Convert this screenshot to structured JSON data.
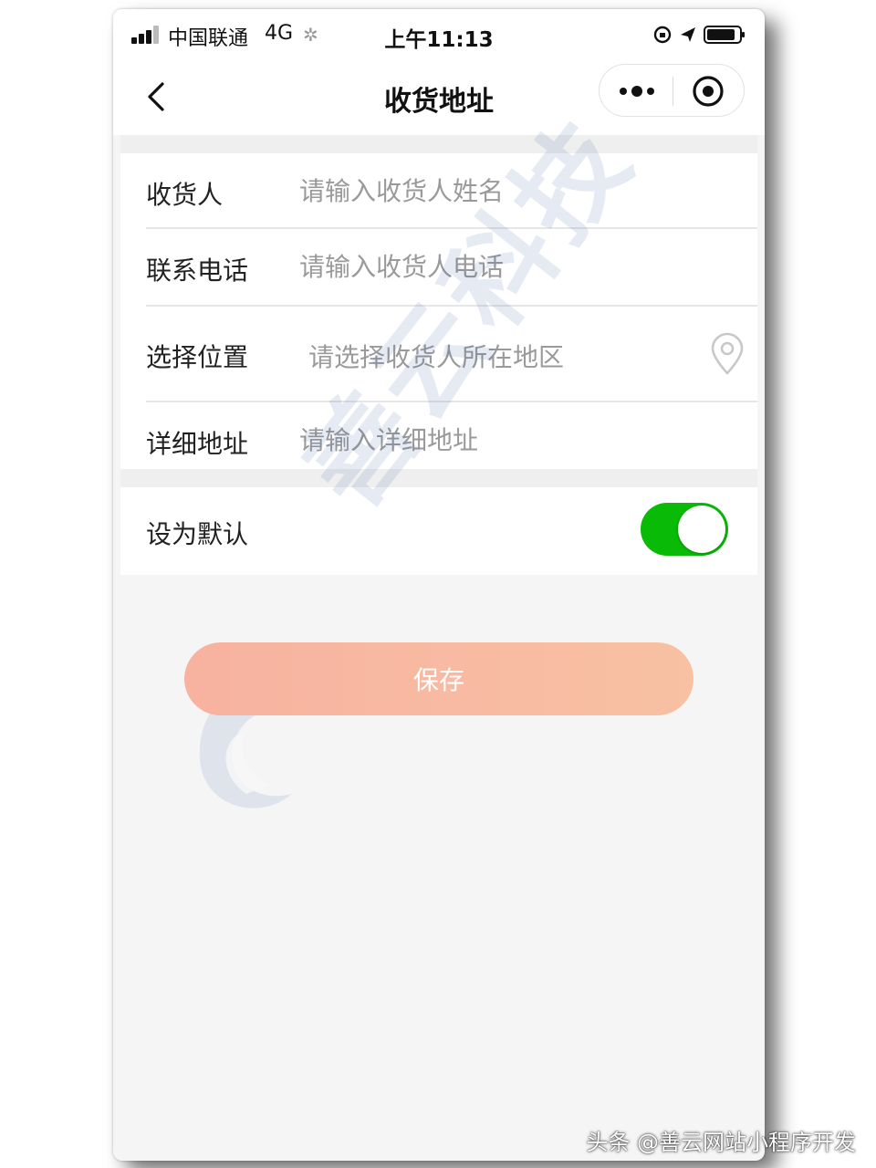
{
  "status_bar": {
    "carrier": "中国联通",
    "network": "4G",
    "time": "上午11:13"
  },
  "nav": {
    "title": "收货地址",
    "back_icon": "chevron-left-icon",
    "more_icon": "more-dots-icon",
    "close_icon": "target-icon"
  },
  "form": {
    "recipient": {
      "label": "收货人",
      "placeholder": "请输入收货人姓名",
      "value": ""
    },
    "phone": {
      "label": "联系电话",
      "placeholder": "请输入收货人电话",
      "value": ""
    },
    "location": {
      "label": "选择位置",
      "placeholder": "请选择收货人所在地区",
      "icon": "location-pin-icon"
    },
    "detail": {
      "label": "详细地址",
      "placeholder": "请输入详细地址",
      "value": ""
    }
  },
  "default_setting": {
    "label": "设为默认",
    "enabled": true,
    "active_color": "#09bb07"
  },
  "actions": {
    "save_label": "保存",
    "save_gradient_start": "#f7b2a0",
    "save_gradient_end": "#f8c1a3"
  },
  "watermark": {
    "text": "善云科技"
  },
  "footer": {
    "credit": "头条 @善云网站小程序开发"
  }
}
